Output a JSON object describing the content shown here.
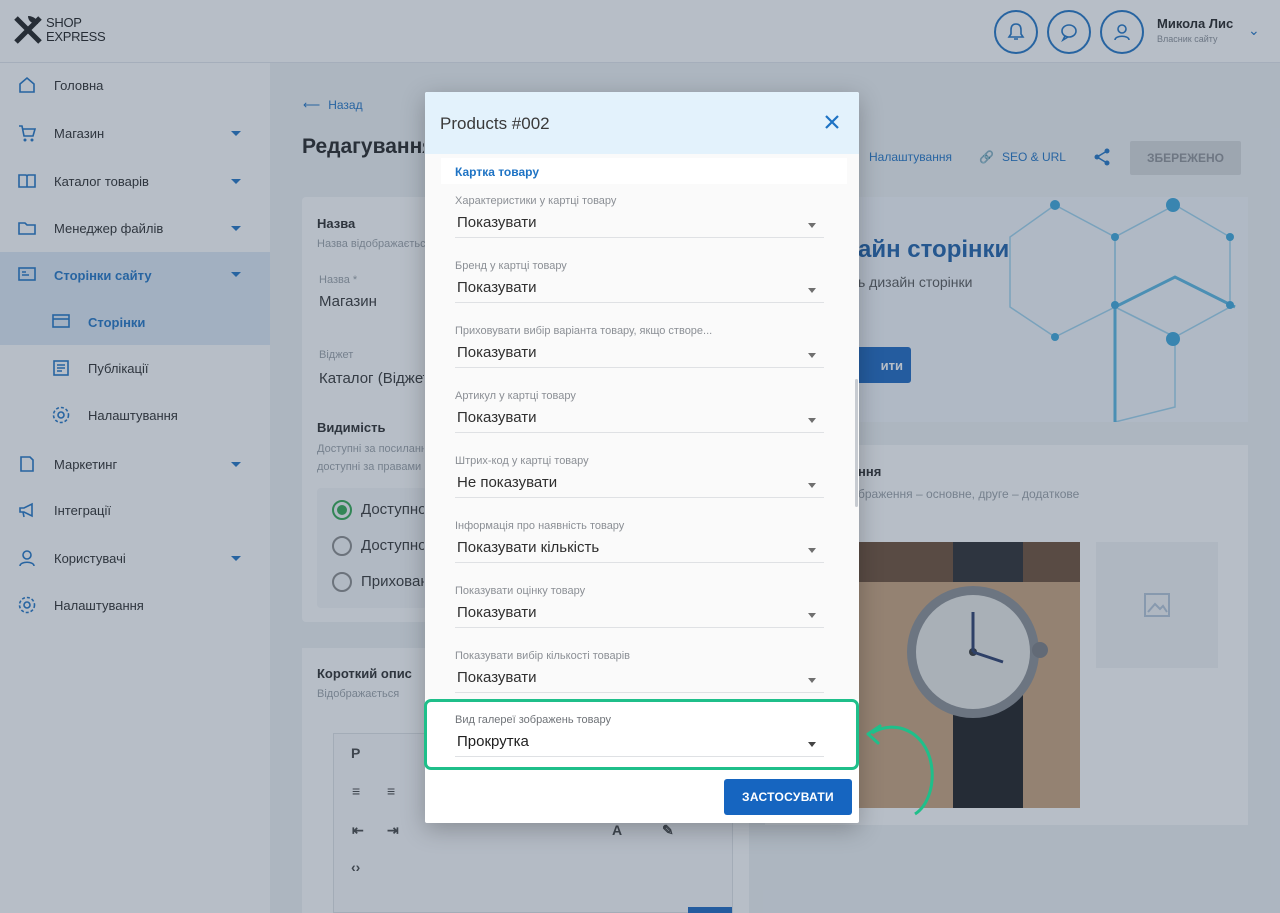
{
  "topbar": {
    "logo_line1": "SHOP",
    "logo_line2": "EXPRESS",
    "user_name": "Микола Лис",
    "user_role": "Власник сайту",
    "icons": [
      "bell-icon",
      "chat-icon",
      "user-icon"
    ]
  },
  "sidebar": {
    "items": [
      {
        "label": "Головна",
        "icon": "home-icon"
      },
      {
        "label": "Магазин",
        "icon": "cart-icon"
      },
      {
        "label": "Каталог товарів",
        "icon": "book-icon"
      },
      {
        "label": "Менеджер файлів",
        "icon": "folder-icon"
      },
      {
        "label": "Сторінки сайту",
        "icon": "pages-icon"
      },
      {
        "label": "Сторінки",
        "icon": "page-icon"
      },
      {
        "label": "Публікації",
        "icon": "news-icon"
      },
      {
        "label": "Налаштування",
        "icon": "gear-icon"
      },
      {
        "label": "Маркетинг",
        "icon": "tag-icon"
      },
      {
        "label": "Інтеграції",
        "icon": "megaphone-icon"
      },
      {
        "label": "Користувачі",
        "icon": "users-icon"
      },
      {
        "label": "Налаштування",
        "icon": "settings-icon"
      }
    ]
  },
  "page": {
    "back": "Назад",
    "title": "Редагування",
    "name_title": "Назва",
    "name_hint": "Назва відображається",
    "name_label": "Назва *",
    "name_value": "Магазин",
    "widget_label": "Віджет",
    "widget_value": "Каталог (Віджет)",
    "visibility_title": "Видимість",
    "visibility_hint1": "Доступні за посиланням",
    "visibility_hint2": "доступні за правами",
    "radio1": "Доступно",
    "radio2": "Доступно",
    "radio3": "Приховано",
    "short_desc_title": "Короткий опис",
    "short_desc_hint": "Відображається",
    "editor_p": "P"
  },
  "toolbar": {
    "settings": "Налаштування",
    "seo": "SEO & URL",
    "save": "ЗБЕРЕЖЕНО"
  },
  "hero": {
    "title": "айн сторінки",
    "subtitle": "ь дизайн сторінки",
    "button": "ити"
  },
  "gallery": {
    "title": "ння",
    "hint": "браження – основне, друге – додаткове"
  },
  "modal": {
    "title": "Products #002",
    "section": "Картка товару",
    "fields": [
      {
        "label": "Характеристики у картці товару",
        "value": "Показувати"
      },
      {
        "label": "Бренд у картці товару",
        "value": "Показувати"
      },
      {
        "label": "Приховувати вибір варіанта товару, якщо створе...",
        "value": "Показувати"
      },
      {
        "label": "Артикул у картці товару",
        "value": "Показувати"
      },
      {
        "label": "Штрих-код у картці товару",
        "value": "Не показувати"
      },
      {
        "label": "Інформація про наявність товару",
        "value": "Показувати кількість"
      },
      {
        "label": "Показувати оцінку товару",
        "value": "Показувати"
      },
      {
        "label": "Показувати вибір кількості товарів",
        "value": "Показувати"
      }
    ],
    "highlighted_field": {
      "label": "Вид галереї зображень товару",
      "value": "Прокрутка"
    },
    "apply": "ЗАСТОСУВАТИ"
  },
  "colors": {
    "accent": "#1665c0",
    "highlight": "#1fbf8a",
    "modal_header": "#e3f2fc"
  }
}
